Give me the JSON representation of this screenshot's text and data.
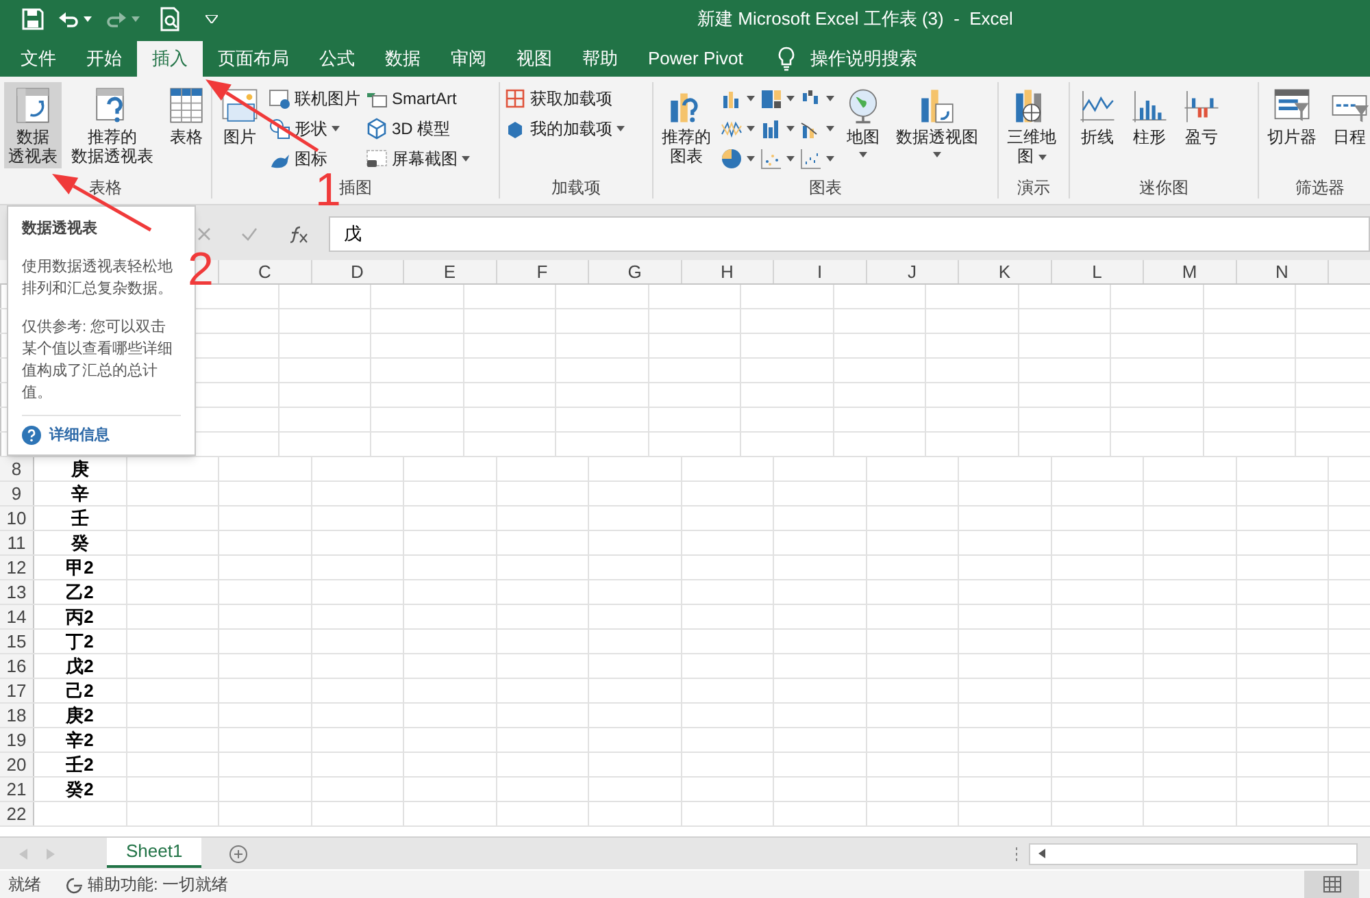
{
  "title_bar": {
    "title": "新建 Microsoft Excel 工作表 (3)  -  Excel"
  },
  "tabs": [
    {
      "label": "文件",
      "selected": false
    },
    {
      "label": "开始",
      "selected": false
    },
    {
      "label": "插入",
      "selected": true
    },
    {
      "label": "页面布局",
      "selected": false
    },
    {
      "label": "公式",
      "selected": false
    },
    {
      "label": "数据",
      "selected": false
    },
    {
      "label": "审阅",
      "selected": false
    },
    {
      "label": "视图",
      "selected": false
    },
    {
      "label": "帮助",
      "selected": false
    },
    {
      "label": "Power Pivot",
      "selected": false
    }
  ],
  "tell_me": "操作说明搜索",
  "ribbon": {
    "groups": [
      {
        "label": "表格",
        "items": [
          {
            "kind": "large",
            "lines": [
              "数据",
              "透视表"
            ],
            "selected": true
          },
          {
            "kind": "large",
            "lines": [
              "推荐的",
              "数据透视表"
            ],
            "selected": false
          },
          {
            "kind": "large",
            "lines": [
              "表格"
            ],
            "selected": false
          }
        ]
      },
      {
        "label": "插图",
        "items": [
          {
            "kind": "large",
            "lines": [
              "图片"
            ],
            "selected": false
          },
          {
            "kind": "small",
            "label": "联机图片",
            "dropdown": false
          },
          {
            "kind": "small",
            "label": "形状",
            "dropdown": true
          },
          {
            "kind": "small",
            "label": "图标",
            "dropdown": false
          },
          {
            "kind": "small",
            "label": "SmartArt",
            "dropdown": false
          },
          {
            "kind": "small",
            "label": "3D 模型",
            "dropdown": false
          },
          {
            "kind": "small",
            "label": "屏幕截图",
            "dropdown": true
          }
        ]
      },
      {
        "label": "加载项",
        "items": [
          {
            "kind": "small",
            "label": "获取加载项",
            "dropdown": false
          },
          {
            "kind": "small",
            "label": "我的加载项",
            "dropdown": true
          }
        ]
      },
      {
        "label": "图表",
        "items": [
          {
            "kind": "large",
            "lines": [
              "推荐的",
              "图表"
            ],
            "selected": false
          },
          {
            "kind": "chart_icon"
          },
          {
            "kind": "chart_icon"
          },
          {
            "kind": "chart_icon"
          },
          {
            "kind": "chart_icon"
          },
          {
            "kind": "chart_icon"
          },
          {
            "kind": "chart_icon"
          },
          {
            "kind": "chart_icon"
          },
          {
            "kind": "chart_icon"
          },
          {
            "kind": "chart_icon"
          },
          {
            "kind": "large",
            "lines": [
              "地图"
            ],
            "selected": false,
            "dropdown": true
          },
          {
            "kind": "large",
            "lines": [
              "数据透视图"
            ],
            "selected": false,
            "dropdown": true
          }
        ]
      },
      {
        "label": "演示",
        "items": [
          {
            "kind": "large",
            "lines": [
              "三维地",
              "图"
            ],
            "selected": false,
            "dropdown": true
          }
        ]
      },
      {
        "label": "迷你图",
        "items": [
          {
            "kind": "large",
            "lines": [
              "折线"
            ],
            "selected": false
          },
          {
            "kind": "large",
            "lines": [
              "柱形"
            ],
            "selected": false
          },
          {
            "kind": "large",
            "lines": [
              "盈亏"
            ],
            "selected": false
          }
        ]
      },
      {
        "label": "筛选器",
        "items": [
          {
            "kind": "large",
            "lines": [
              "切片器"
            ],
            "selected": false
          },
          {
            "kind": "large",
            "lines": [
              "日程"
            ],
            "selected": false
          }
        ]
      }
    ]
  },
  "formula_bar": {
    "value": "戊"
  },
  "sheet": {
    "columns": [
      "C",
      "D",
      "E",
      "F",
      "G",
      "H",
      "I",
      "J",
      "K",
      "L",
      "M",
      "N"
    ],
    "rows": [
      {
        "number": "8",
        "a": "庚"
      },
      {
        "number": "9",
        "a": "辛"
      },
      {
        "number": "10",
        "a": "壬"
      },
      {
        "number": "11",
        "a": "癸"
      },
      {
        "number": "12",
        "a": "甲2"
      },
      {
        "number": "13",
        "a": "乙2"
      },
      {
        "number": "14",
        "a": "丙2"
      },
      {
        "number": "15",
        "a": "丁2"
      },
      {
        "number": "16",
        "a": "戊2"
      },
      {
        "number": "17",
        "a": "己2"
      },
      {
        "number": "18",
        "a": "庚2"
      },
      {
        "number": "19",
        "a": "辛2"
      },
      {
        "number": "20",
        "a": "壬2"
      },
      {
        "number": "21",
        "a": "癸2"
      },
      {
        "number": "22",
        "a": ""
      }
    ]
  },
  "tooltip": {
    "title": "数据透视表",
    "paragraphs": [
      "使用数据透视表轻松地排列和汇总复杂数据。",
      "仅供参考: 您可以双击某个值以查看哪些详细值构成了汇总的总计值。"
    ],
    "link": "详细信息"
  },
  "annotations": [
    {
      "label": "1"
    },
    {
      "label": "2"
    }
  ],
  "sheet_tabs": [
    {
      "label": "Sheet1",
      "selected": true
    }
  ],
  "status_bar": {
    "state": "就绪",
    "accessibility": "辅助功能: 一切就绪"
  }
}
